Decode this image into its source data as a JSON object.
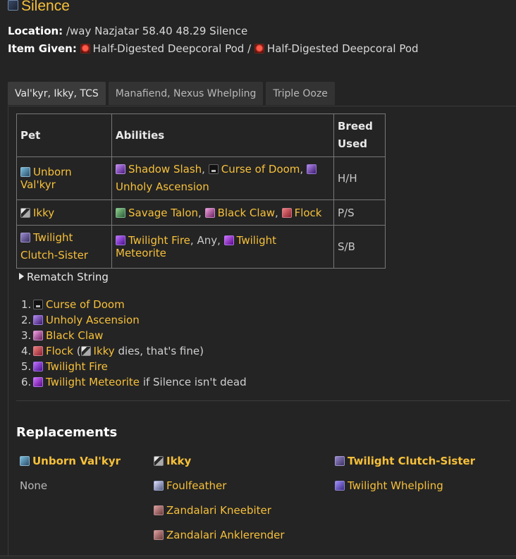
{
  "header": {
    "title": "Silence",
    "location_label": "Location:",
    "location_value": "/way Nazjatar 58.40 48.29 Silence",
    "item_label": "Item Given:",
    "item_1": "Half-Digested Deepcoral Pod",
    "item_sep": "/",
    "item_2": "Half-Digested Deepcoral Pod"
  },
  "tabs": [
    {
      "label": "Val'kyr, Ikky, TCS",
      "active": true
    },
    {
      "label": "Manafiend, Nexus Whelpling",
      "active": false
    },
    {
      "label": "Triple Ooze",
      "active": false
    }
  ],
  "table": {
    "headers": [
      "Pet",
      "Abilities",
      "Breed Used"
    ],
    "rows": [
      {
        "pet": "Unborn Val'kyr",
        "abilities": [
          "Shadow Slash",
          "Curse of Doom",
          "Unholy Ascension"
        ],
        "breed": "H/H"
      },
      {
        "pet": "Ikky",
        "abilities": [
          "Savage Talon",
          "Black Claw",
          "Flock"
        ],
        "breed": "P/S"
      },
      {
        "pet": "Twilight Clutch-Sister",
        "abilities": [
          "Twilight Fire",
          "Any",
          "Twilight Meteorite"
        ],
        "breed": "S/B"
      }
    ]
  },
  "rematch_label": "Rematch String",
  "steps": [
    {
      "n": "1.",
      "ability": "Curse of Doom"
    },
    {
      "n": "2.",
      "ability": "Unholy Ascension"
    },
    {
      "n": "3.",
      "ability": "Black Claw"
    },
    {
      "n": "4.",
      "ability": "Flock",
      "pre": "(",
      "pet": "Ikky",
      "post": "dies, that's fine)"
    },
    {
      "n": "5.",
      "ability": "Twilight Fire"
    },
    {
      "n": "6.",
      "ability": "Twilight Meteorite",
      "post": "if Silence isn't dead"
    }
  ],
  "replacements": {
    "title": "Replacements",
    "col1": {
      "head": "Unborn Val'kyr",
      "items": [
        "None"
      ]
    },
    "col2": {
      "head": "Ikky",
      "items": [
        "Foulfeather",
        "Zandalari Kneebiter",
        "Zandalari Anklerender"
      ]
    },
    "col3": {
      "head": "Twilight Clutch-Sister",
      "items": [
        "Twilight Whelpling"
      ]
    }
  },
  "colors": {
    "accent": "#f6c03a",
    "background": "#242424"
  }
}
